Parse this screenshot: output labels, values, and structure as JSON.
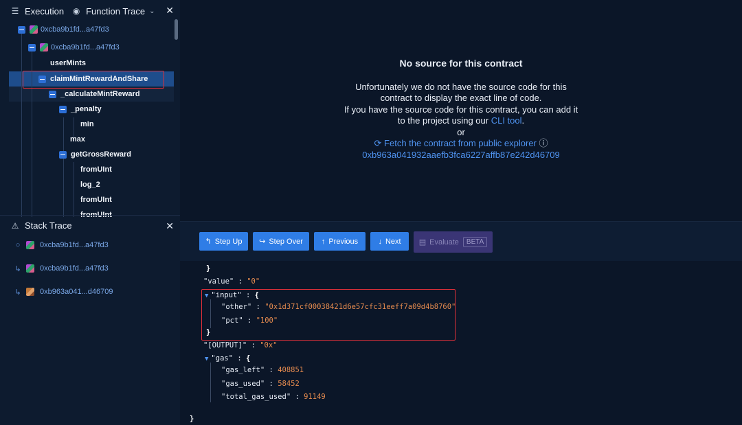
{
  "execution_panel": {
    "title": "Execution",
    "mode": "Function Trace",
    "tree": [
      {
        "label": "0xcba9b1fd...a47fd3"
      },
      {
        "label": "0xcba9b1fd...a47fd3"
      },
      {
        "label": "userMints"
      },
      {
        "label": "claimMintRewardAndShare"
      },
      {
        "label": "_calculateMintReward"
      },
      {
        "label": "_penalty"
      },
      {
        "label": "min"
      },
      {
        "label": "max"
      },
      {
        "label": "getGrossReward"
      },
      {
        "label": "fromUInt"
      },
      {
        "label": "log_2"
      },
      {
        "label": "fromUInt"
      },
      {
        "label": "fromUInt"
      }
    ]
  },
  "stack_panel": {
    "title": "Stack Trace",
    "items": [
      {
        "label": "0xcba9b1fd...a47fd3"
      },
      {
        "label": "0xcba9b1fd...a47fd3"
      },
      {
        "label": "0xb963a041...d46709"
      }
    ]
  },
  "no_source": {
    "title": "No source for this contract",
    "line1": "Unfortunately we do not have the source code for this",
    "line2": "contract to display the exact line of code.",
    "line3": "If you have the source code for this contract, you can add it",
    "line4a": "to the project using our ",
    "line4_link": "CLI tool",
    "line4b": ".",
    "or": "or",
    "fetch_link": "Fetch the contract from public explorer",
    "address": "0xb963a041932aaefb3fca6227affb87e242d46709"
  },
  "toolbar": {
    "step_up": "Step Up",
    "step_over": "Step Over",
    "previous": "Previous",
    "next": "Next",
    "evaluate": "Evaluate",
    "beta": "BETA"
  },
  "json_view": {
    "value_key": "\"value\"",
    "value_val": "\"0\"",
    "input_key": "\"input\"",
    "other_key": "\"other\"",
    "other_val": "\"0x1d371cf00038421d6e57cfc31eeff7a09d4b8760\"",
    "pct_key": "\"pct\"",
    "pct_val": "\"100\"",
    "output_key": "\"[OUTPUT]\"",
    "output_val": "\"0x\"",
    "gas_key": "\"gas\"",
    "gas_left_key": "\"gas_left\"",
    "gas_left_val": "408851",
    "gas_used_key": "\"gas_used\"",
    "gas_used_val": "58452",
    "total_gas_used_key": "\"total_gas_used\"",
    "total_gas_used_val": "91149"
  },
  "colors": {
    "accent": "#2f7de6",
    "highlight_border": "#e0303a",
    "json_string": "#e58b4f"
  }
}
